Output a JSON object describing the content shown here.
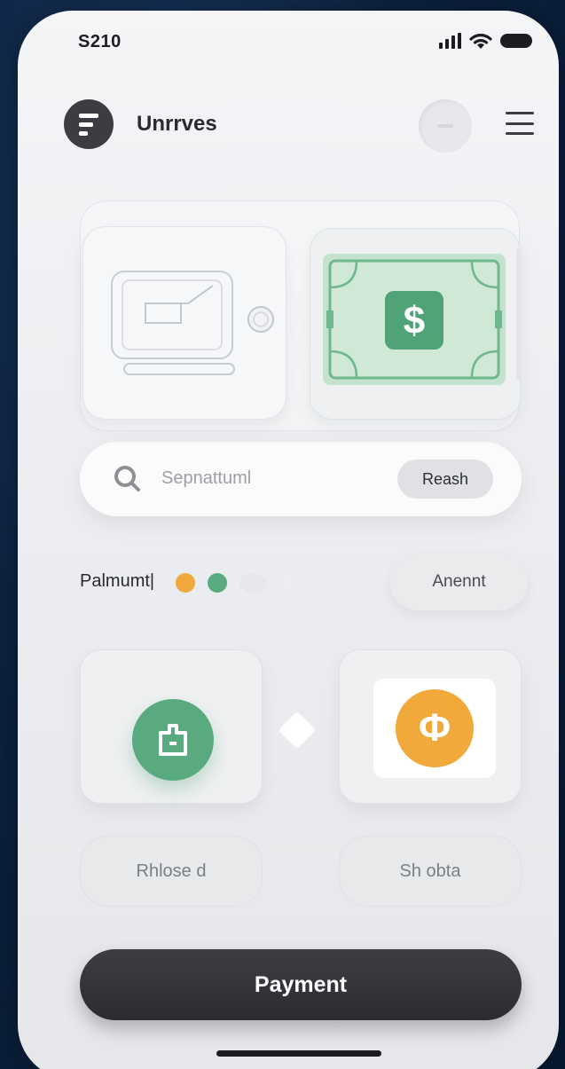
{
  "status_bar": {
    "time": "S210"
  },
  "header": {
    "app_title": "Unrrves"
  },
  "hero": {
    "money_symbol": "$"
  },
  "search": {
    "placeholder": "Sepnattuml",
    "button_label": "Reash"
  },
  "payment_row": {
    "label": "Palmumt|",
    "amount_button": "Anennt",
    "dot_colors": [
      "#f0a93a",
      "#5aaa80",
      "#e6e7ea",
      "#ecedf0"
    ]
  },
  "tiles": {
    "right_symbol": "Φ"
  },
  "options": {
    "left_label": "Rhlose d",
    "right_label": "Sh obta"
  },
  "primary_action": {
    "label": "Payment"
  },
  "colors": {
    "accent_green": "#5aaa80",
    "accent_orange": "#f0a93a",
    "dark": "#2f3136"
  }
}
